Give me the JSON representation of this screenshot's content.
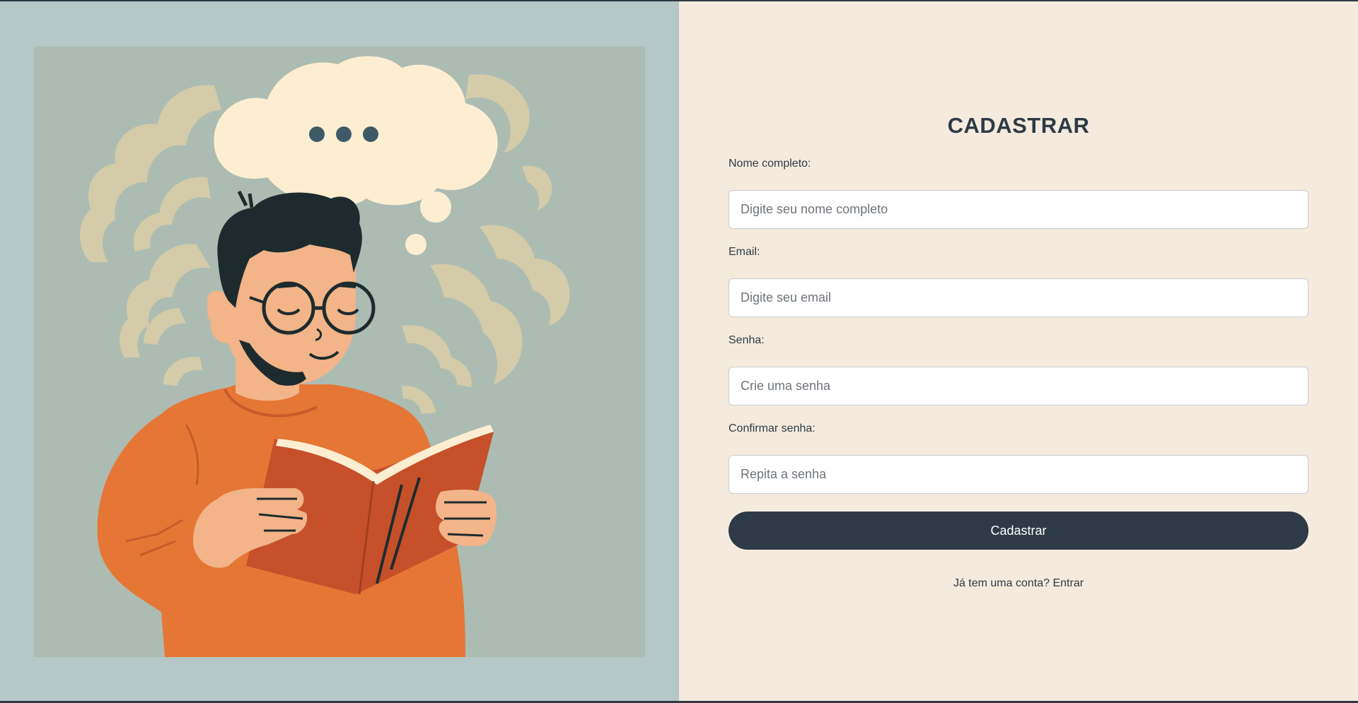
{
  "form": {
    "title": "CADASTRAR",
    "fields": [
      {
        "label": "Nome completo:",
        "placeholder": "Digite seu nome completo",
        "value": ""
      },
      {
        "label": "Email:",
        "placeholder": "Digite seu email",
        "value": ""
      },
      {
        "label": "Senha:",
        "placeholder": "Crie uma senha",
        "value": ""
      },
      {
        "label": "Confirmar senha:",
        "placeholder": "Repita a senha",
        "value": ""
      }
    ],
    "submit_label": "Cadastrar",
    "login_prompt": "Já tem uma conta?",
    "login_link": "Entrar"
  },
  "illustration": {
    "subject": "person-reading-book-with-thought-bubble"
  },
  "colors": {
    "left_background": "#b5c7c6",
    "illustration_background": "#adbcb2",
    "right_background": "#f4ebde",
    "primary": "#2e3a46",
    "sweater": "#e67636",
    "book": "#c6502a",
    "skin": "#f2b488",
    "hair": "#1e2b2e",
    "cloud": "#fdeed2"
  }
}
